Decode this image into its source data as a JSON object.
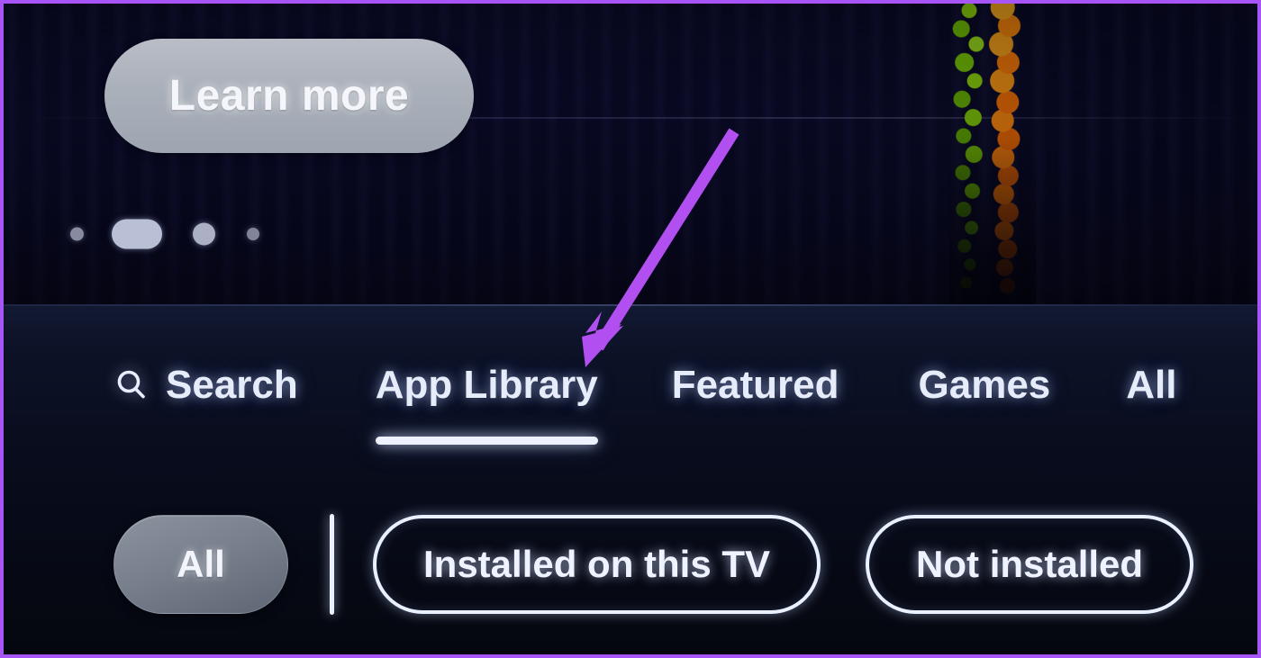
{
  "annotation": {
    "frame_color": "#a855f7",
    "arrow_color": "#b24ff0",
    "arrow_target": "App Library",
    "arrow_name": "purple-pointer-arrow"
  },
  "hero": {
    "name": "promo-banner",
    "cta_label": "Learn more",
    "background_description": "blue stage curtain with marigold garland",
    "carousel": {
      "total_slides": 4,
      "active_slide": 2,
      "dots": [
        {
          "state": "inactive",
          "name": "carousel-dot-1"
        },
        {
          "state": "active",
          "name": "carousel-dot-2"
        },
        {
          "state": "inactive",
          "name": "carousel-dot-3"
        },
        {
          "state": "inactive",
          "name": "carousel-dot-4"
        }
      ]
    }
  },
  "nav": {
    "selected": "App Library",
    "items": [
      {
        "label": "Search",
        "icon": "search-icon",
        "selected": false
      },
      {
        "label": "App Library",
        "icon": null,
        "selected": true
      },
      {
        "label": "Featured",
        "icon": null,
        "selected": false
      },
      {
        "label": "Games",
        "icon": null,
        "selected": false
      },
      {
        "label": "All",
        "icon": null,
        "selected": false,
        "clipped": true
      }
    ]
  },
  "filters": {
    "selected": "All",
    "chips": [
      {
        "label": "All",
        "style": "solid",
        "selected": true
      },
      {
        "label": "Installed on this TV",
        "style": "outline",
        "selected": false
      },
      {
        "label": "Not installed",
        "style": "outline",
        "selected": false,
        "clipped": true
      }
    ]
  },
  "colors": {
    "panel_background": "#06080f",
    "accent_purple": "#a855f7",
    "chip_text": "#eef3ff",
    "chip_solid_fill": "#777f8c",
    "nav_text": "#e7ecfb",
    "curtain_blue": "#2a1cae",
    "garland_orange": "#ff9c22",
    "garland_green": "#8ccb26"
  }
}
